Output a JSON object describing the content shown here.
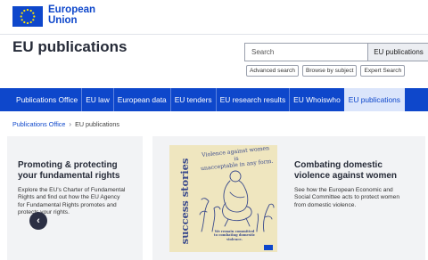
{
  "brand": {
    "line1": "European",
    "line2": "Union"
  },
  "site_title": "EU publications",
  "search": {
    "placeholder": "Search",
    "button_label": "EU publications"
  },
  "sublinks": [
    "Advanced search",
    "Browse by subject",
    "Expert Search"
  ],
  "nav": [
    {
      "label": "Publications Office",
      "active": false
    },
    {
      "label": "EU law",
      "active": false
    },
    {
      "label": "European data",
      "active": false
    },
    {
      "label": "EU tenders",
      "active": false
    },
    {
      "label": "EU research results",
      "active": false
    },
    {
      "label": "EU Whoiswho",
      "active": false
    },
    {
      "label": "EU publications",
      "active": true
    }
  ],
  "breadcrumb": {
    "home": "Publications Office",
    "current": "EU publications"
  },
  "cards": {
    "left": {
      "title_line1": "Promoting & protecting",
      "title_line2": "your fundamental rights",
      "desc_line1": "Explore the EU's Charter of Fundamental",
      "desc_line2": "Rights and find out how the EU Agency",
      "desc_line3": "for Fundamental Rights promotes and",
      "desc_line4": "protects your rights."
    },
    "right": {
      "title_line1": "Combating domestic",
      "title_line2": "violence against women",
      "desc_line1": "See how the European Economic and",
      "desc_line2": "Social Committee acts to protect women",
      "desc_line3": "from domestic violence."
    }
  },
  "poster": {
    "side_text": "success stories",
    "head_line1": "Violence against women is",
    "head_line2": "unacceptable in any form.",
    "foot_line1": "We remain committed",
    "foot_line2": "to combating domestic",
    "foot_line3": "violence."
  },
  "icons": {
    "prev": "chevron-left-icon",
    "eu_flag": "eu-flag-icon"
  },
  "colors": {
    "brand_blue": "#0e47cb",
    "nav_active_bg": "#dbe5fb",
    "poster_bg": "#efe6bf",
    "poster_ink": "#3a4a8c"
  }
}
